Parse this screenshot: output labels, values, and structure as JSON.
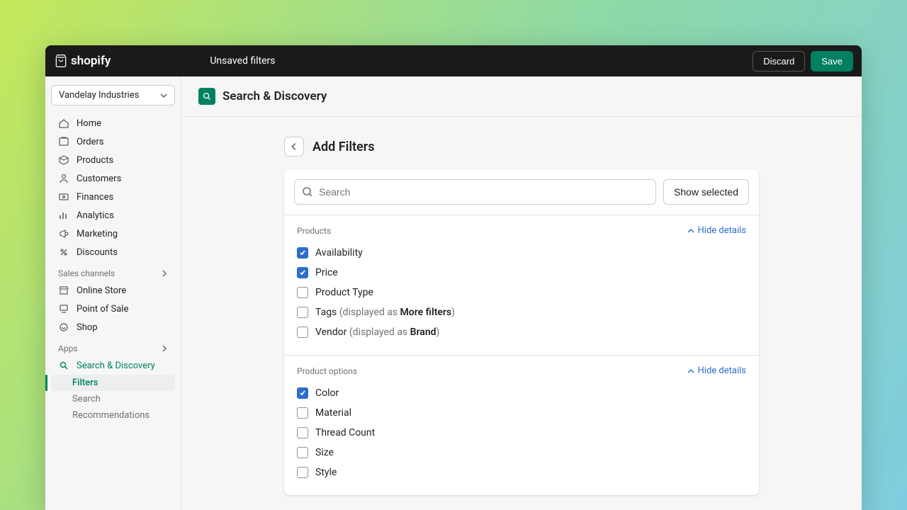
{
  "topbar": {
    "brand": "shopify",
    "status": "Unsaved filters",
    "discard": "Discard",
    "save": "Save"
  },
  "sidebar": {
    "store": "Vandelay Industries",
    "nav": [
      {
        "label": "Home",
        "icon": "home"
      },
      {
        "label": "Orders",
        "icon": "orders"
      },
      {
        "label": "Products",
        "icon": "products"
      },
      {
        "label": "Customers",
        "icon": "customers"
      },
      {
        "label": "Finances",
        "icon": "finances"
      },
      {
        "label": "Analytics",
        "icon": "analytics"
      },
      {
        "label": "Marketing",
        "icon": "marketing"
      },
      {
        "label": "Discounts",
        "icon": "discounts"
      }
    ],
    "channels_header": "Sales channels",
    "channels": [
      {
        "label": "Online Store",
        "icon": "store"
      },
      {
        "label": "Point of Sale",
        "icon": "pos"
      },
      {
        "label": "Shop",
        "icon": "shop"
      }
    ],
    "apps_header": "Apps",
    "apps": [
      {
        "label": "Search & Discovery",
        "icon": "search-app",
        "active": true
      }
    ],
    "app_sub": [
      {
        "label": "Filters",
        "active": true
      },
      {
        "label": "Search",
        "active": false
      },
      {
        "label": "Recommendations",
        "active": false
      }
    ]
  },
  "app_header": {
    "title": "Search & Discovery"
  },
  "page": {
    "title": "Add Filters",
    "search_placeholder": "Search",
    "show_selected": "Show selected",
    "sections": [
      {
        "title": "Products",
        "hide": "Hide details",
        "items": [
          {
            "label": "Availability",
            "checked": true
          },
          {
            "label": "Price",
            "checked": true
          },
          {
            "label": "Product Type",
            "checked": false
          },
          {
            "label": "Tags",
            "suffix_dim": " (displayed as ",
            "suffix_bold": "More filters",
            "suffix_end": ")",
            "checked": false
          },
          {
            "label": "Vendor",
            "suffix_dim": " (displayed as ",
            "suffix_bold": "Brand",
            "suffix_end": ")",
            "checked": false
          }
        ]
      },
      {
        "title": "Product options",
        "hide": "Hide details",
        "items": [
          {
            "label": "Color",
            "checked": true
          },
          {
            "label": "Material",
            "checked": false
          },
          {
            "label": "Thread Count",
            "checked": false
          },
          {
            "label": "Size",
            "checked": false
          },
          {
            "label": "Style",
            "checked": false
          }
        ]
      }
    ]
  }
}
